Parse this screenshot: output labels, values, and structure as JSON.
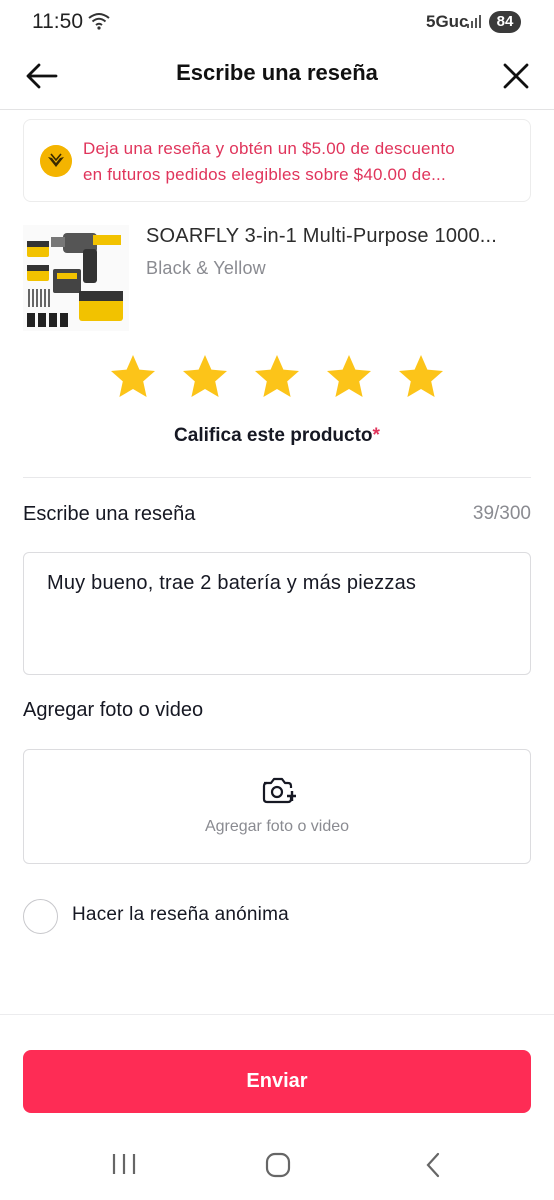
{
  "status_bar": {
    "time": "11:50",
    "network": "5Guc",
    "battery": "84"
  },
  "header": {
    "title": "Escribe una reseña",
    "back_icon": "arrow-left-icon",
    "close_icon": "close-icon"
  },
  "promo": {
    "line1": "Deja una reseña y obtén un $5.00 de descuento",
    "line2": "en futuros pedidos elegibles sobre $40.00 de...",
    "color": "#e0345b"
  },
  "product": {
    "title": "SOARFLY 3-in-1 Multi-Purpose 1000...",
    "variant": "Black & Yellow"
  },
  "rating": {
    "value": 5,
    "max": 5,
    "star_color": "#fcc419",
    "label": "Califica este producto",
    "required_mark": "*"
  },
  "review": {
    "label": "Escribe una reseña",
    "count": "39/300",
    "text": "Muy bueno, trae 2 batería y más piezzas"
  },
  "media": {
    "label": "Agregar foto o video",
    "hint": "Agregar foto o video",
    "icon": "camera-plus-icon"
  },
  "anonymous": {
    "label": "Hacer la reseña anónima",
    "checked": false
  },
  "submit": {
    "label": "Enviar",
    "color": "#fe2c55"
  }
}
